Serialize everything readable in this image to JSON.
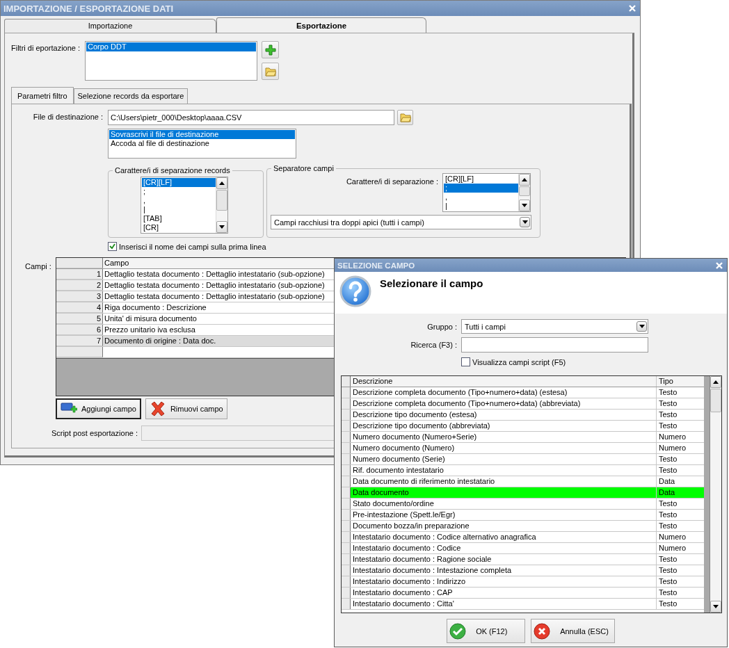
{
  "main_window": {
    "title": "IMPORTAZIONE / ESPORTAZIONE DATI",
    "tabs": [
      {
        "label": "Importazione",
        "selected": false
      },
      {
        "label": "Esportazione",
        "selected": true
      }
    ],
    "filters": {
      "label": "Filtri di eportazione :",
      "items": [
        {
          "text": "Corpo DDT",
          "selected": true
        }
      ]
    },
    "subtabs": [
      {
        "label": "Parametri filtro",
        "selected": true
      },
      {
        "label": "Selezione records da esportare",
        "selected": false
      }
    ],
    "destination": {
      "label": "File di destinazione :",
      "value": "C:\\Users\\pietr_000\\Desktop\\aaaa.CSV"
    },
    "write_mode": [
      {
        "text": "Sovrascrivi il file di destinazione",
        "selected": true
      },
      {
        "text": "Accoda al file di destinazione",
        "selected": false
      }
    ],
    "record_separator": {
      "title": "Carattere/i di separazione records",
      "items": [
        {
          "text": "[CR][LF]",
          "selected": true
        },
        {
          "text": ";",
          "selected": false
        },
        {
          "text": ",",
          "selected": false
        },
        {
          "text": "|",
          "selected": false
        },
        {
          "text": "[TAB]",
          "selected": false
        },
        {
          "text": "[CR]",
          "selected": false
        }
      ]
    },
    "field_separator": {
      "title": "Separatore campi",
      "label": "Carattere/i di separazione :",
      "items": [
        {
          "text": "[CR][LF]",
          "selected": false
        },
        {
          "text": ";",
          "selected": true
        },
        {
          "text": ",",
          "selected": false
        },
        {
          "text": "|",
          "selected": false
        }
      ],
      "quoting": "Campi racchiusi tra doppi apici (tutti i campi)"
    },
    "header_checkbox": {
      "label": "Inserisci il nome dei campi sulla prima linea",
      "checked": true
    },
    "fields": {
      "label": "Campi :",
      "columns": [
        "Campo"
      ],
      "rows": [
        {
          "number": "1",
          "field": "Dettaglio testata documento : Dettaglio intestatario (sub-opzione)",
          "selected": false
        },
        {
          "number": "2",
          "field": "Dettaglio testata documento : Dettaglio intestatario (sub-opzione)",
          "selected": false
        },
        {
          "number": "3",
          "field": "Dettaglio testata documento : Dettaglio intestatario (sub-opzione)",
          "selected": false
        },
        {
          "number": "4",
          "field": "Riga documento : Descrizione",
          "selected": false
        },
        {
          "number": "5",
          "field": "Unita' di misura documento",
          "selected": false
        },
        {
          "number": "6",
          "field": "Prezzo unitario iva esclusa",
          "selected": false
        },
        {
          "number": "7",
          "field": "Documento di origine : Data doc.",
          "selected": true
        }
      ]
    },
    "buttons": [
      {
        "label": "Aggiungi campo",
        "kind": "add"
      },
      {
        "label": "Rimuovi campo",
        "kind": "remove"
      }
    ],
    "script": {
      "label": "Script post esportazione :"
    }
  },
  "dialog": {
    "title": "SELEZIONE CAMPO",
    "heading": "Selezionare il campo",
    "group": {
      "label": "Gruppo :",
      "value": "Tutti i campi"
    },
    "search": {
      "label": "Ricerca (F3) :"
    },
    "script_checkbox": {
      "label": "Visualizza campi script (F5)",
      "checked": false
    },
    "table": {
      "columns": [
        "Descrizione",
        "Tipo"
      ],
      "rows": [
        {
          "description": "Descrizione completa documento (Tipo+numero+data) (estesa)",
          "type": "Testo",
          "selected": false
        },
        {
          "description": "Descrizione completa documento (Tipo+numero+data) (abbreviata)",
          "type": "Testo",
          "selected": false
        },
        {
          "description": "Descrizione tipo documento (estesa)",
          "type": "Testo",
          "selected": false
        },
        {
          "description": "Descrizione tipo documento (abbreviata)",
          "type": "Testo",
          "selected": false
        },
        {
          "description": "Numero documento (Numero+Serie)",
          "type": "Numero",
          "selected": false
        },
        {
          "description": "Numero documento (Numero)",
          "type": "Numero",
          "selected": false
        },
        {
          "description": "Numero documento (Serie)",
          "type": "Testo",
          "selected": false
        },
        {
          "description": "Rif. documento intestatario",
          "type": "Testo",
          "selected": false
        },
        {
          "description": "Data documento di riferimento intestatario",
          "type": "Data",
          "selected": false
        },
        {
          "description": "Data documento",
          "type": "Data",
          "selected": true
        },
        {
          "description": "Stato documento/ordine",
          "type": "Testo",
          "selected": false
        },
        {
          "description": "Pre-intestazione (Spett.le/Egr)",
          "type": "Testo",
          "selected": false
        },
        {
          "description": "Documento bozza/in preparazione",
          "type": "Testo",
          "selected": false
        },
        {
          "description": "Intestatario documento : Codice alternativo anagrafica",
          "type": "Numero",
          "selected": false
        },
        {
          "description": "Intestatario documento : Codice",
          "type": "Numero",
          "selected": false
        },
        {
          "description": "Intestatario documento : Ragione sociale",
          "type": "Testo",
          "selected": false
        },
        {
          "description": "Intestatario documento : Intestazione completa",
          "type": "Testo",
          "selected": false
        },
        {
          "description": "Intestatario documento : Indirizzo",
          "type": "Testo",
          "selected": false
        },
        {
          "description": "Intestatario documento : CAP",
          "type": "Testo",
          "selected": false
        },
        {
          "description": "Intestatario documento : Citta'",
          "type": "Testo",
          "selected": false
        }
      ]
    },
    "buttons": [
      {
        "label": "OK (F12)",
        "kind": "ok"
      },
      {
        "label": "Annulla (ESC)",
        "kind": "cancel"
      }
    ]
  }
}
